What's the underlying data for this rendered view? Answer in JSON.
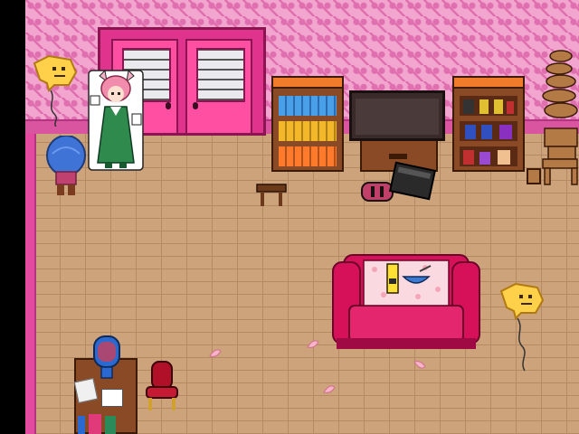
{
  "scene": {
    "colors": {
      "wall": "#f2a6cf",
      "heart": "#e06fb0",
      "floor": "#cda37b",
      "floor_line": "#b58a63",
      "trim": "#e34aa0",
      "door": "#ff4fa3",
      "sofa": "#d6115a",
      "void": "#000000"
    },
    "icons": [
      "balloon-icon",
      "character-sprite",
      "door-icon",
      "bookshelf-icon",
      "tv-icon",
      "stool-icon",
      "console-icon",
      "sofa-icon",
      "desk-icon",
      "chair-icon",
      "crate-stack-icon",
      "petal-icon"
    ]
  }
}
